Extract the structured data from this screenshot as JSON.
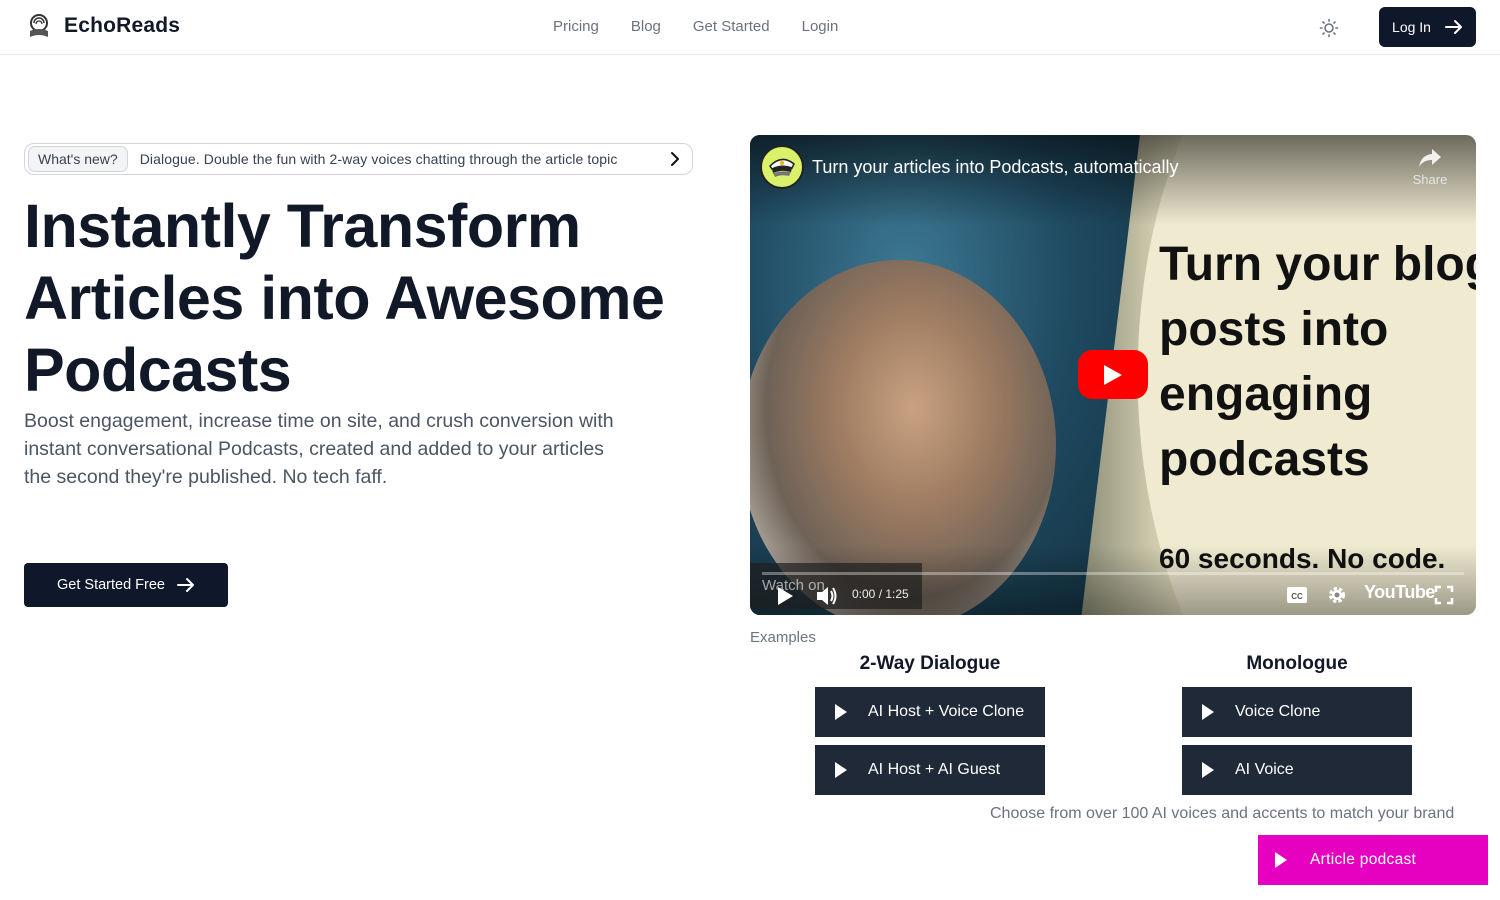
{
  "header": {
    "brand": "EchoReads",
    "nav": [
      {
        "label": "Pricing"
      },
      {
        "label": "Blog"
      },
      {
        "label": "Get Started"
      },
      {
        "label": "Login"
      }
    ],
    "theme_toggle_icon": "sun-icon",
    "login_label": "Log In"
  },
  "hero": {
    "whats_new_badge": "What's new?",
    "whats_new_text": "Dialogue. Double the fun with 2-way voices chatting through the article topic",
    "title": "Instantly Transform Articles into Awesome Podcasts",
    "subtitle": "Boost engagement, increase time on site, and crush conversion with instant conversational Podcasts, created and added to your articles the second they're published. No tech faff.",
    "cta_label": "Get Started Free"
  },
  "video": {
    "title": "Turn your articles into Podcasts, automatically",
    "share_label": "Share",
    "overlay_headline": "Turn your blog posts into engaging podcasts",
    "overlay_headline_lines": [
      "Turn your blog",
      "posts into",
      "engaging",
      "podcasts"
    ],
    "overlay_tagline": "60 seconds. No code.",
    "watch_on_label": "Watch on",
    "youtube_label": "YouTube",
    "current_time": "0:00",
    "duration": "1:25",
    "time_display": "0:00 / 1:25",
    "progress_percent": 0
  },
  "examples": {
    "label": "Examples",
    "columns": [
      {
        "title": "2-Way Dialogue",
        "items": [
          {
            "label": "AI Host + Voice Clone"
          },
          {
            "label": "AI Host + AI Guest"
          }
        ]
      },
      {
        "title": "Monologue",
        "items": [
          {
            "label": "Voice Clone"
          },
          {
            "label": "AI Voice"
          }
        ]
      }
    ],
    "voices_note": "Choose from over 100 AI voices and accents to match your brand"
  },
  "floating_player": {
    "label": "Article podcast",
    "color": "#e600bf"
  },
  "colors": {
    "primary_dark": "#0f172a",
    "example_button": "#1f2937",
    "youtube_red": "#ff0000",
    "accent_magenta": "#e600bf"
  }
}
